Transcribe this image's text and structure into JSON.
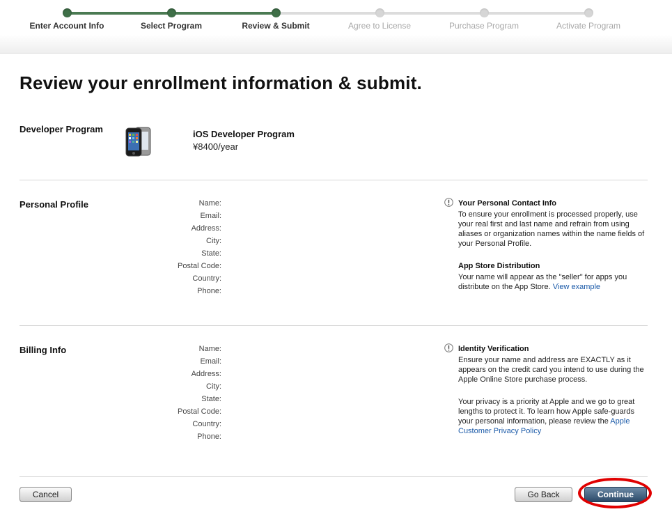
{
  "progress": {
    "steps": [
      {
        "label": "Enter Account Info",
        "state": "done"
      },
      {
        "label": "Select Program",
        "state": "done"
      },
      {
        "label": "Review & Submit",
        "state": "done"
      },
      {
        "label": "Agree to License",
        "state": "todo"
      },
      {
        "label": "Purchase Program",
        "state": "todo"
      },
      {
        "label": "Activate Program",
        "state": "todo"
      }
    ],
    "colors": {
      "done": "#4a7a52",
      "todo": "#d6d6d6"
    }
  },
  "page": {
    "title": "Review your enrollment information & submit."
  },
  "developer_program": {
    "section_title": "Developer Program",
    "icon": "iphone-icon",
    "program_name": "iOS Developer Program",
    "price": "¥8400/year"
  },
  "personal_profile": {
    "section_title": "Personal Profile",
    "fields": [
      "Name:",
      "Email:",
      "Address:",
      "City:",
      "State:",
      "Postal Code:",
      "Country:",
      "Phone:"
    ],
    "info": {
      "contact_heading": "Your Personal Contact Info",
      "contact_text": "To ensure your enrollment is processed properly, use your real first and last name and refrain from using aliases or organization names within the name fields of your Personal Profile.",
      "distribution_heading": "App Store Distribution",
      "distribution_text": "Your name will appear as the \"seller\" for apps you distribute on the App Store.",
      "distribution_link": "View example"
    }
  },
  "billing_info": {
    "section_title": "Billing Info",
    "fields": [
      "Name:",
      "Email:",
      "Address:",
      "City:",
      "State:",
      "Postal Code:",
      "Country:",
      "Phone:"
    ],
    "info": {
      "verification_heading": "Identity Verification",
      "verification_text": "Ensure your name and address are EXACTLY as it appears on the credit card you intend to use during the Apple Online Store purchase process.",
      "privacy_text": "Your privacy is a priority at Apple and we go to great lengths to protect it. To learn how Apple safe-guards your personal information, please review the",
      "privacy_link": "Apple Customer Privacy Policy"
    }
  },
  "buttons": {
    "cancel": "Cancel",
    "go_back": "Go Back",
    "continue": "Continue"
  },
  "annotation": {
    "color": "#e00000"
  }
}
